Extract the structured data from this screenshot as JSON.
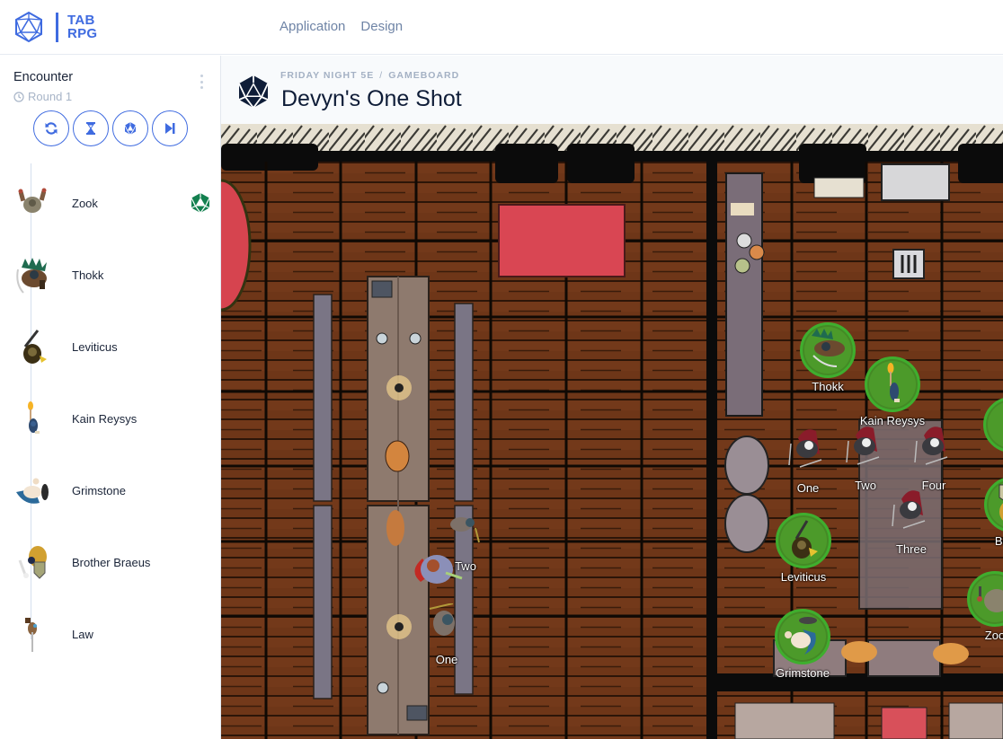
{
  "app": {
    "logo_line1": "TAB",
    "logo_line2": "RPG",
    "brand_color": "#3f6be0"
  },
  "topnav": [
    {
      "label": "Application"
    },
    {
      "label": "Design"
    }
  ],
  "encounter": {
    "title": "Encounter",
    "round": "Round 1",
    "controls": [
      {
        "icon": "refresh-icon",
        "label": "Reroll initiative"
      },
      {
        "icon": "hourglass-icon",
        "label": "Delay"
      },
      {
        "icon": "d20-icon",
        "label": "Roll"
      },
      {
        "icon": "next-turn-icon",
        "label": "Next turn"
      }
    ],
    "combatants": [
      {
        "name": "Zook",
        "active": true
      },
      {
        "name": "Thokk",
        "active": false
      },
      {
        "name": "Leviticus",
        "active": false
      },
      {
        "name": "Kain Reysys",
        "active": false
      },
      {
        "name": "Grimstone",
        "active": false
      },
      {
        "name": "Brother Braeus",
        "active": false
      },
      {
        "name": "Law",
        "active": false
      }
    ],
    "active_turn_color": "#13804f"
  },
  "header": {
    "breadcrumb": [
      "FRIDAY NIGHT 5E",
      "GAMEBOARD"
    ],
    "breadcrumb_separator": "/",
    "title": "Devyn's One Shot"
  },
  "board": {
    "player_tokens": [
      {
        "name": "Thokk"
      },
      {
        "name": "Kain Reysys"
      },
      {
        "name": "Leviticus"
      },
      {
        "name": "Grimstone"
      },
      {
        "name": "Brothe"
      },
      {
        "name": "Zoo"
      }
    ],
    "enemy_tokens": [
      {
        "name": "One"
      },
      {
        "name": "Two"
      },
      {
        "name": "Four"
      },
      {
        "name": "Three"
      }
    ],
    "other_tokens": [
      {
        "name": "Two"
      },
      {
        "name": "One"
      }
    ],
    "token_ring_color": "#3fae2e"
  }
}
